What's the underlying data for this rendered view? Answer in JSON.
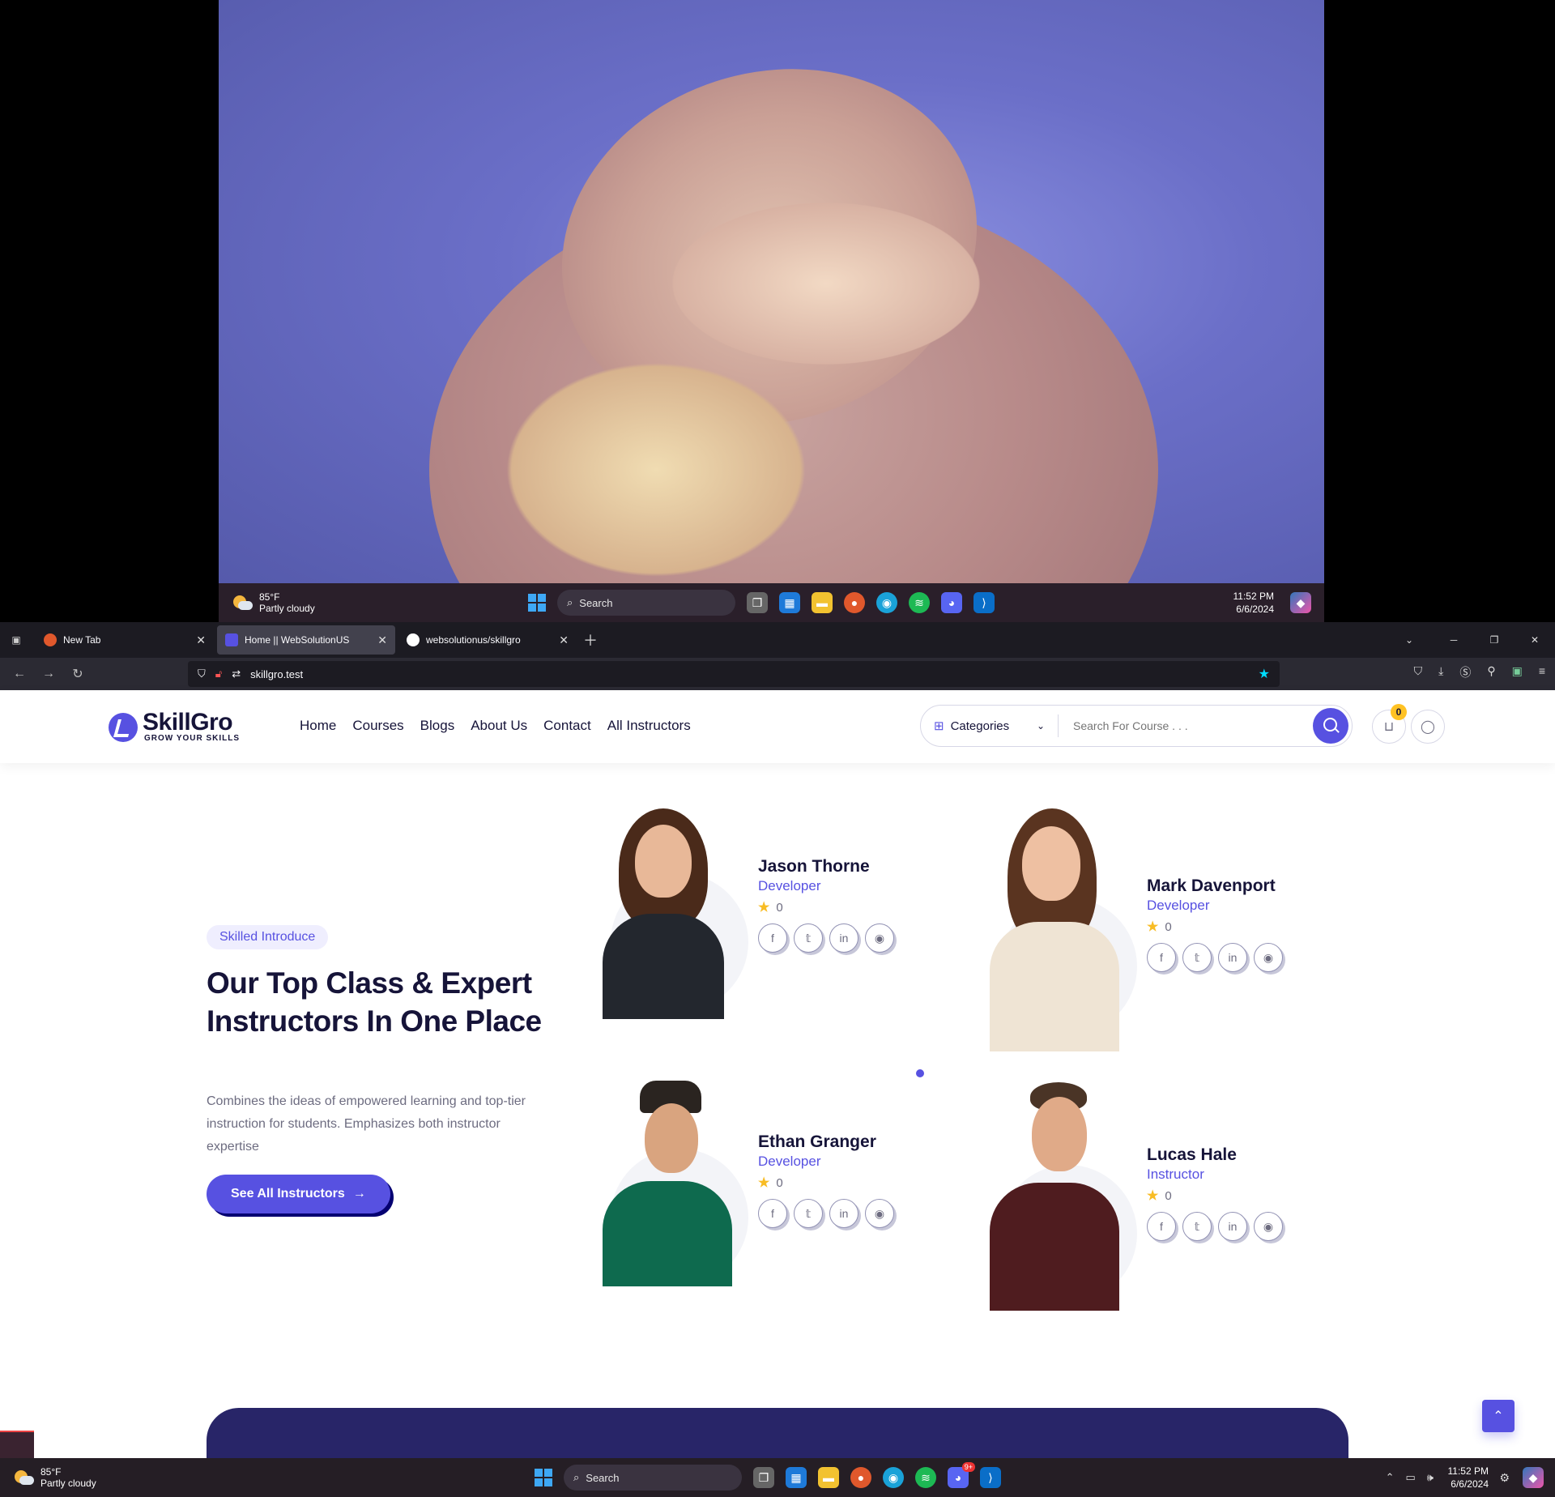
{
  "taskbar": {
    "temperature": "85°F",
    "weather": "Partly cloudy",
    "search_label": "Search",
    "time": "11:52 PM",
    "date": "6/6/2024",
    "discord_badge": "9+"
  },
  "browser": {
    "tabs": [
      {
        "label": "New Tab"
      },
      {
        "label": "Home || WebSolutionUS"
      },
      {
        "label": "websolutionus/skillgro"
      }
    ],
    "url": "skillgro.test"
  },
  "site": {
    "logo_title": "SkillGro",
    "logo_tagline": "GROW YOUR SKILLS",
    "menu": [
      "Home",
      "Courses",
      "Blogs",
      "About Us",
      "Contact",
      "All Instructors"
    ],
    "categories_label": "Categories",
    "search_placeholder": "Search For Course . . .",
    "cart_count": "0"
  },
  "intro": {
    "tag": "Skilled Introduce",
    "title": "Our Top Class & Expert Instructors In One Place",
    "description": "Combines the ideas of empowered learning and top-tier instruction for students. Emphasizes both instructor expertise",
    "button_label": "See All Instructors"
  },
  "instructors": [
    {
      "name": "Jason Thorne",
      "role": "Developer",
      "rating": "0"
    },
    {
      "name": "Mark Davenport",
      "role": "Developer",
      "rating": "0"
    },
    {
      "name": "Ethan Granger",
      "role": "Developer",
      "rating": "0"
    },
    {
      "name": "Lucas Hale",
      "role": "Instructor",
      "rating": "0"
    }
  ],
  "colors": {
    "accent": "#5751e1",
    "heading": "#161439",
    "star": "#f8bc24",
    "banner": "#282568"
  }
}
